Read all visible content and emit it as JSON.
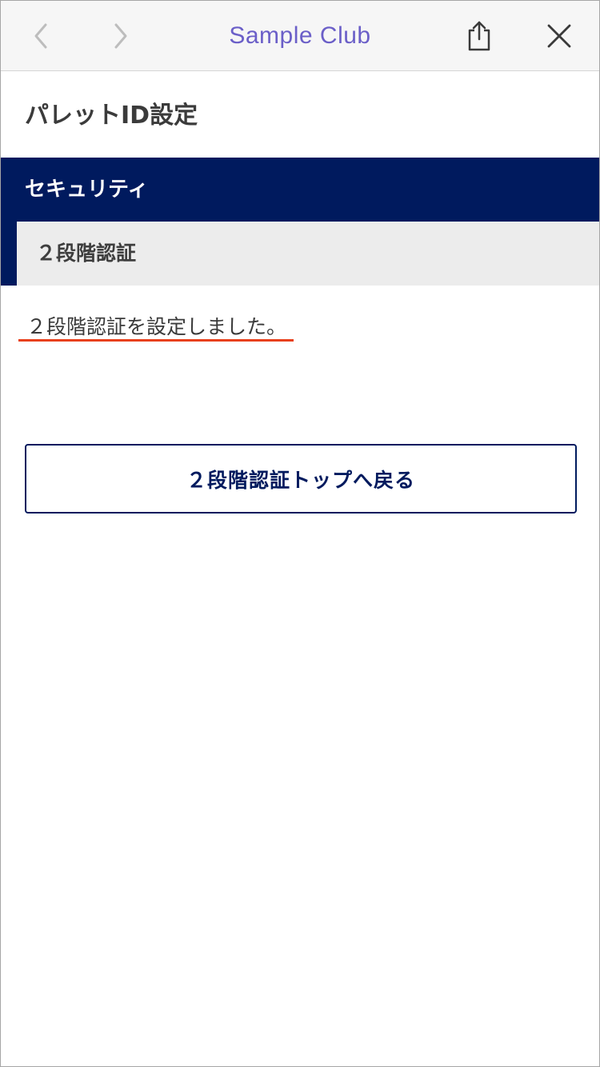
{
  "browser": {
    "title": "Sample Club",
    "icons": {
      "back": "chevron-left-icon",
      "forward": "chevron-right-icon",
      "share": "share-icon",
      "close": "close-icon"
    }
  },
  "page": {
    "heading": "パレットID設定"
  },
  "section": {
    "label": "セキュリティ"
  },
  "subsection": {
    "label": "２段階認証"
  },
  "message": {
    "text": "２段階認証を設定しました。"
  },
  "actions": {
    "return_label": "２段階認証トップへ戻る"
  },
  "colors": {
    "navy": "#001a5e",
    "title_purple": "#6b5fc8",
    "underline_red": "#e8401c",
    "subsection_grey": "#ececec"
  }
}
